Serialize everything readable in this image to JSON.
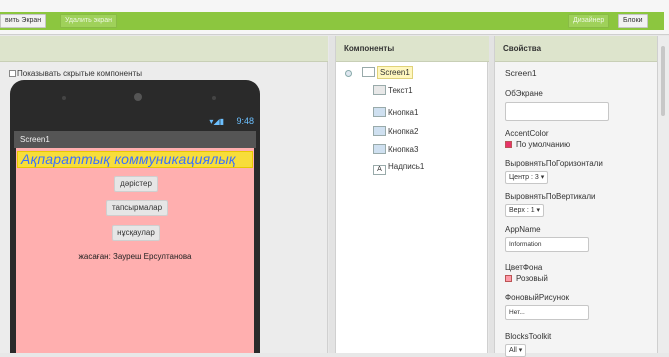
{
  "toolbar": {
    "add_screen": "вить Экран",
    "remove_screen": "Удалить экран",
    "designer": "Дизайнер",
    "blocks": "Блоки"
  },
  "viewer": {
    "show_hidden": "Показывать скрытые компоненты",
    "screen_title": "Screen1",
    "status_time": "9:48",
    "banner_text": "Ақпараттық коммуникациялық",
    "buttons": [
      "дәрістер",
      "тапсырмалар",
      "нұсқаулар"
    ],
    "credit": "жасаған: Зауреш Ерсултанова"
  },
  "components": {
    "header": "Компоненты",
    "root": "Screen1",
    "children": [
      "Текст1",
      "Кнопка1",
      "Кнопка2",
      "Кнопка3",
      "Надпись1"
    ]
  },
  "properties": {
    "header": "Свойства",
    "component": "Screen1",
    "about_label": "ОбЭкране",
    "about_value": "",
    "accent_label": "AccentColor",
    "accent_value": "По умолчанию",
    "align_h_label": "ВыровнятьПоГоризонтали",
    "align_h_value": "Центр : 3 ▾",
    "align_v_label": "ВыровнятьПоВертикали",
    "align_v_value": "Верх : 1 ▾",
    "appname_label": "AppName",
    "appname_value": "Information",
    "bgcolor_label": "ЦветФона",
    "bgcolor_value": "Розовый",
    "bgimage_label": "ФоновыйРисунок",
    "bgimage_value": "Нет...",
    "blocks_toolkit_label": "BlocksToolkit",
    "blocks_toolkit_value": "All ▾"
  },
  "colors": {
    "toolbar_green": "#8cc63f",
    "screen_bg": "#ffafaf",
    "banner_bg": "#f7dd3a",
    "banner_text": "#3a6fff",
    "accent_swatch": "#e8336a",
    "pink_swatch": "#ff9aa8"
  }
}
